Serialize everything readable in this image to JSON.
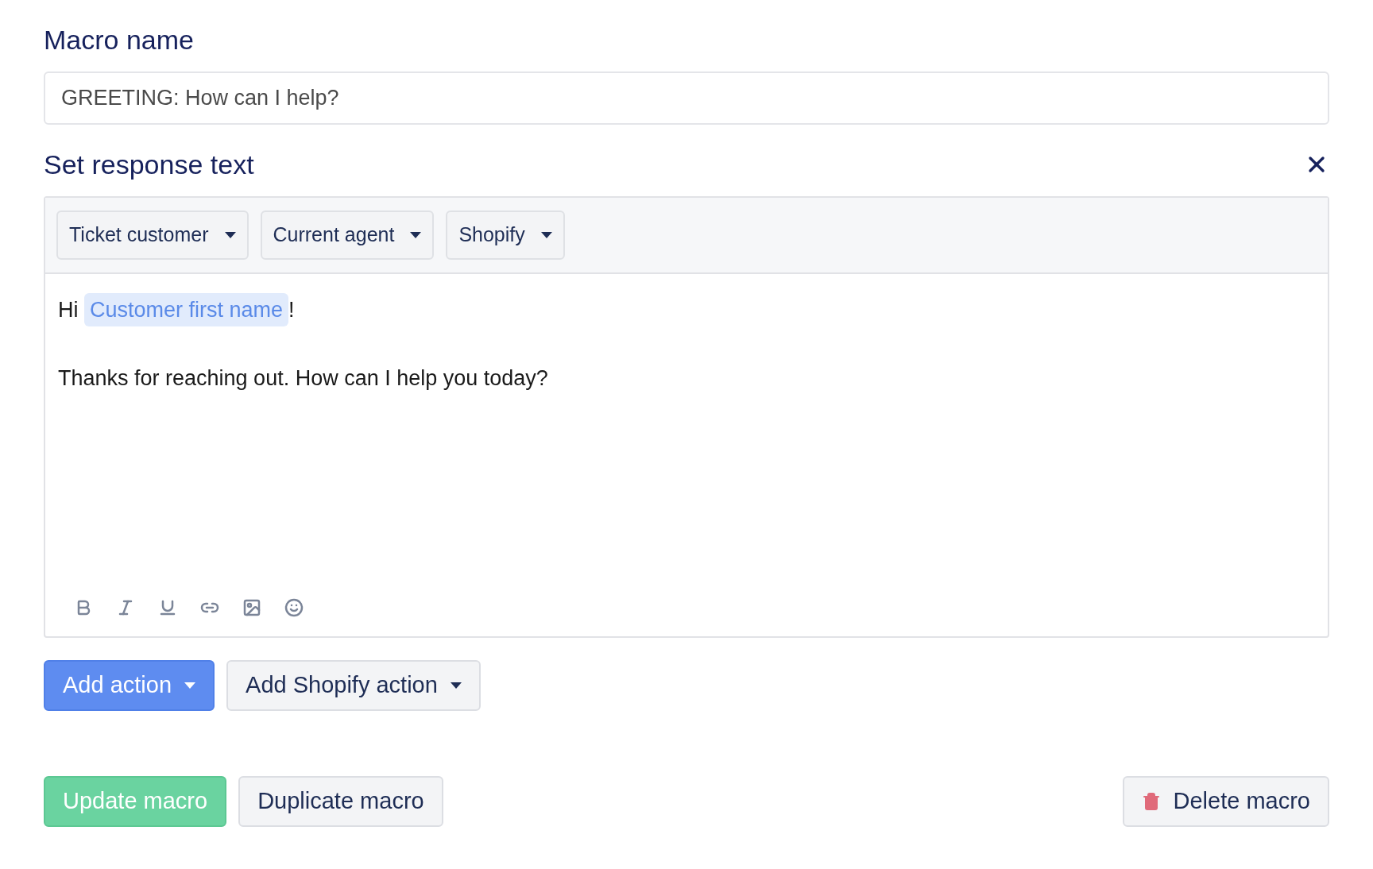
{
  "macro_name": {
    "label": "Macro name",
    "value": "GREETING: How can I help?"
  },
  "response": {
    "title": "Set response text",
    "variable_menus": [
      "Ticket customer",
      "Current agent",
      "Shopify"
    ],
    "lines": [
      [
        {
          "kind": "text",
          "text": "Hi "
        },
        {
          "kind": "variable",
          "text": "Customer first name"
        },
        {
          "kind": "text",
          "text": "!"
        }
      ],
      [
        {
          "kind": "text",
          "text": "Thanks for reaching out. How can I help you today?"
        }
      ]
    ]
  },
  "actions": [
    {
      "label": "Add action",
      "kind": "primary"
    },
    {
      "label": "Add Shopify action",
      "kind": "secondary"
    }
  ],
  "footer": [
    {
      "label": "Update macro",
      "kind": "success"
    },
    {
      "label": "Duplicate macro",
      "kind": "secondary"
    },
    {
      "label": "Delete macro",
      "kind": "danger"
    }
  ]
}
